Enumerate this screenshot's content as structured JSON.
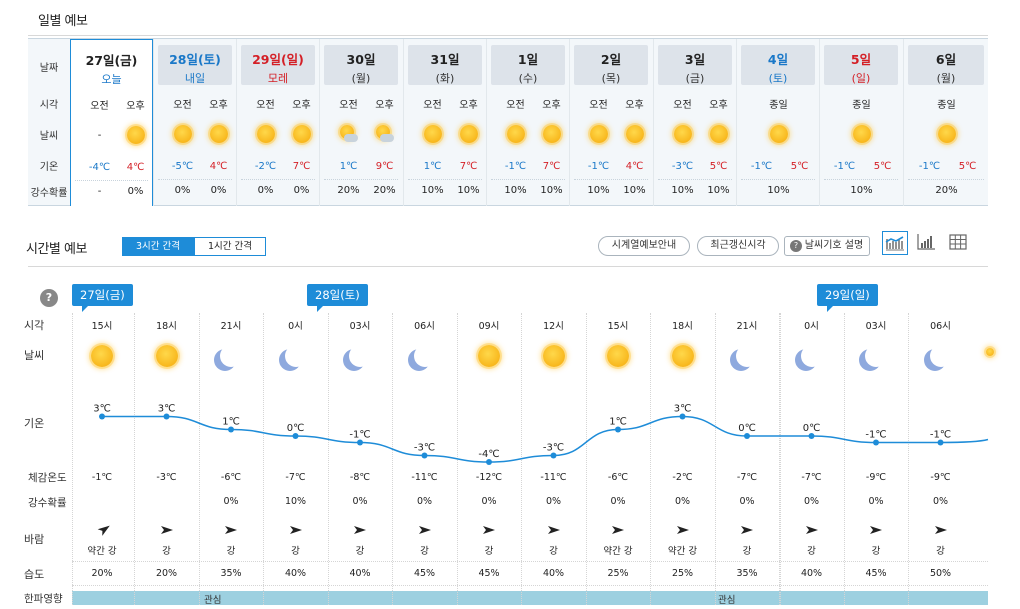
{
  "daily": {
    "title": "일별 예보",
    "row_labels": [
      "날짜",
      "시각",
      "날씨",
      "기온",
      "강수확률"
    ],
    "days": [
      {
        "date": "27일(금)",
        "sub": "오늘",
        "color": "#222222",
        "sub_color": "#1a78c8",
        "split": true,
        "times": [
          "오전",
          "오후"
        ],
        "icons": [
          "",
          "sun"
        ],
        "temps": [
          "-4℃",
          "4℃"
        ],
        "rain": [
          "-",
          "0%"
        ],
        "am_dash": "-"
      },
      {
        "date": "28일(토)",
        "sub": "내일",
        "color": "#1a78c8",
        "sub_color": "#1a78c8",
        "split": true,
        "times": [
          "오전",
          "오후"
        ],
        "icons": [
          "sun",
          "sun"
        ],
        "temps": [
          "-5℃",
          "4℃"
        ],
        "rain": [
          "0%",
          "0%"
        ]
      },
      {
        "date": "29일(일)",
        "sub": "모레",
        "color": "#d41f26",
        "sub_color": "#d41f26",
        "split": true,
        "times": [
          "오전",
          "오후"
        ],
        "icons": [
          "sun",
          "sun"
        ],
        "temps": [
          "-2℃",
          "7℃"
        ],
        "rain": [
          "0%",
          "0%"
        ]
      },
      {
        "date": "30일",
        "sub": "(월)",
        "color": "#222222",
        "sub_color": "#333333",
        "split": true,
        "times": [
          "오전",
          "오후"
        ],
        "icons": [
          "suncloud",
          "suncloud"
        ],
        "temps": [
          "1℃",
          "9℃"
        ],
        "rain": [
          "20%",
          "20%"
        ]
      },
      {
        "date": "31일",
        "sub": "(화)",
        "color": "#222222",
        "sub_color": "#333333",
        "split": true,
        "times": [
          "오전",
          "오후"
        ],
        "icons": [
          "sun",
          "sun"
        ],
        "temps": [
          "1℃",
          "7℃"
        ],
        "rain": [
          "10%",
          "10%"
        ]
      },
      {
        "date": "1일",
        "sub": "(수)",
        "color": "#222222",
        "sub_color": "#333333",
        "split": true,
        "times": [
          "오전",
          "오후"
        ],
        "icons": [
          "sun",
          "sun"
        ],
        "temps": [
          "-1℃",
          "7℃"
        ],
        "rain": [
          "10%",
          "10%"
        ]
      },
      {
        "date": "2일",
        "sub": "(목)",
        "color": "#222222",
        "sub_color": "#333333",
        "split": true,
        "times": [
          "오전",
          "오후"
        ],
        "icons": [
          "sun",
          "sun"
        ],
        "temps": [
          "-1℃",
          "4℃"
        ],
        "rain": [
          "10%",
          "10%"
        ]
      },
      {
        "date": "3일",
        "sub": "(금)",
        "color": "#222222",
        "sub_color": "#333333",
        "split": true,
        "times": [
          "오전",
          "오후"
        ],
        "icons": [
          "sun",
          "sun"
        ],
        "temps": [
          "-3℃",
          "5℃"
        ],
        "rain": [
          "10%",
          "10%"
        ]
      },
      {
        "date": "4일",
        "sub": "(토)",
        "color": "#1a78c8",
        "sub_color": "#1a78c8",
        "split": false,
        "times": [
          "종일"
        ],
        "icons": [
          "sun"
        ],
        "temps": [
          "-1℃",
          "5℃"
        ],
        "rain": [
          "10%"
        ]
      },
      {
        "date": "5일",
        "sub": "(일)",
        "color": "#d41f26",
        "sub_color": "#d41f26",
        "split": false,
        "times": [
          "종일"
        ],
        "icons": [
          "sun"
        ],
        "temps": [
          "-1℃",
          "5℃"
        ],
        "rain": [
          "10%"
        ]
      },
      {
        "date": "6일",
        "sub": "(월)",
        "color": "#222222",
        "sub_color": "#333333",
        "split": false,
        "times": [
          "종일"
        ],
        "icons": [
          "sun"
        ],
        "temps": [
          "-1℃",
          "5℃"
        ],
        "rain": [
          "20%"
        ]
      }
    ]
  },
  "hourly": {
    "title": "시간별 예보",
    "toggle": [
      "3시간 간격",
      "1시간 간격"
    ],
    "buttons": [
      "시계열예보안내",
      "최근갱신시각",
      "날씨기호 설명"
    ],
    "help_glyph": "?",
    "row_labels": [
      "시각",
      "날씨",
      "기온",
      "체감온도",
      "강수확률",
      "바람",
      "습도",
      "한파영향"
    ],
    "date_tags": [
      "27일(금)",
      "28일(토)",
      "29일(일)"
    ],
    "times": [
      "15시",
      "18시",
      "21시",
      "0시",
      "03시",
      "06시",
      "09시",
      "12시",
      "15시",
      "18시",
      "21시",
      "0시",
      "03시",
      "06시"
    ],
    "icons": [
      "sun",
      "sun",
      "moon",
      "moon",
      "moon",
      "moon",
      "sun",
      "sun",
      "sun",
      "sun",
      "moon",
      "moon",
      "moon",
      "moon"
    ],
    "temps": [
      3,
      3,
      1,
      0,
      -1,
      -3,
      -4,
      -3,
      1,
      3,
      0,
      0,
      -1,
      -1
    ],
    "temp_labels": [
      "3℃",
      "3℃",
      "1℃",
      "0℃",
      "-1℃",
      "-3℃",
      "-4℃",
      "-3℃",
      "1℃",
      "3℃",
      "0℃",
      "0℃",
      "-1℃",
      "-1℃"
    ],
    "feels": [
      "-1℃",
      "-3℃",
      "-6℃",
      "-7℃",
      "-8℃",
      "-11℃",
      "-12℃",
      "-11℃",
      "-6℃",
      "-2℃",
      "-7℃",
      "-7℃",
      "-9℃",
      "-9℃"
    ],
    "rain": [
      "",
      "",
      "0%",
      "10%",
      "0%",
      "0%",
      "0%",
      "0%",
      "0%",
      "0%",
      "0%",
      "0%",
      "0%",
      "0%"
    ],
    "wind": [
      "약간 강",
      "강",
      "강",
      "강",
      "강",
      "강",
      "강",
      "강",
      "약간 강",
      "약간 강",
      "강",
      "강",
      "강",
      "강"
    ],
    "humidity": [
      "20%",
      "20%",
      "35%",
      "40%",
      "40%",
      "45%",
      "45%",
      "40%",
      "25%",
      "25%",
      "35%",
      "40%",
      "45%",
      "50%"
    ],
    "cold_impact": [
      "관심",
      "관심"
    ],
    "line_color": "#1e8cd8"
  }
}
